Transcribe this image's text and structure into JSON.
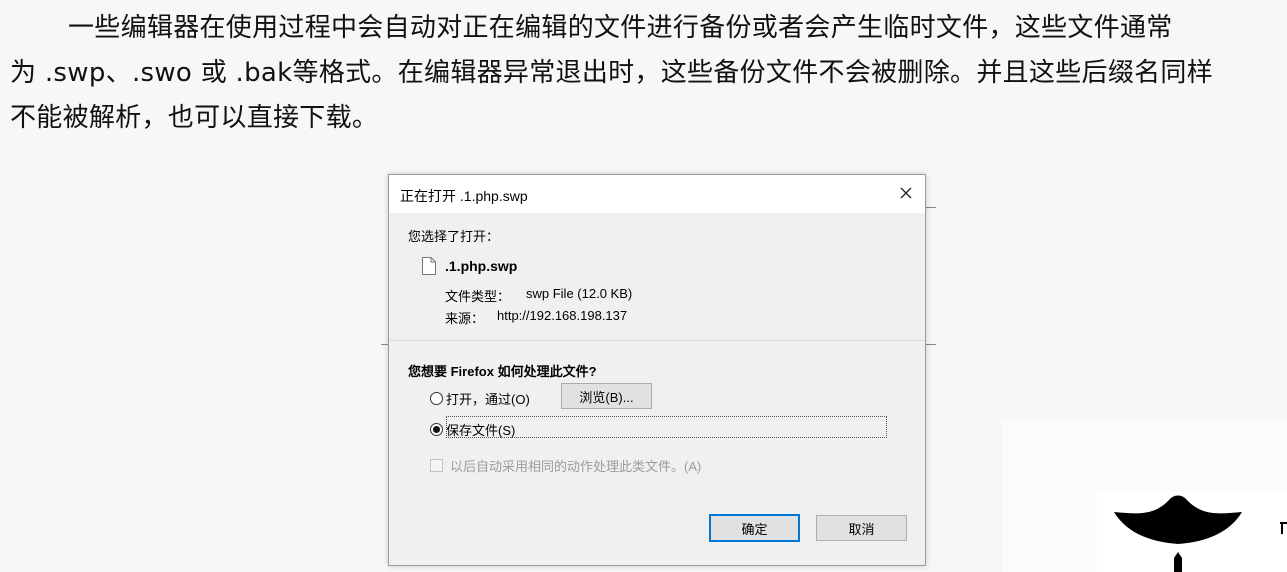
{
  "article": {
    "line1": "一些编辑器在使用过程中会自动对正在编辑的文件进行备份或者会产生临时文件，这些文件通常",
    "line2": "为 .swp、.swo 或 .bak等格式。在编辑器异常退出时，这些备份文件不会被删除。并且这些后缀名同样",
    "line3": "不能被解析，也可以直接下载。"
  },
  "dialog": {
    "title": "正在打开 .1.php.swp",
    "you_chose": "您选择了打开：",
    "file_name": ".1.php.swp",
    "type_label": "文件类型：",
    "type_value": "swp File (12.0 KB)",
    "source_label": "来源：",
    "source_value": "http://192.168.198.137",
    "question": "您想要 Firefox 如何处理此文件?",
    "open_with_label": "打开，通过(O)",
    "browse_button": "浏览(B)...",
    "save_file_label": "保存文件(S)",
    "auto_label": "以后自动采用相同的动作处理此类文件。(A)",
    "ok_button": "确定",
    "cancel_button": "取消",
    "selected_option": "save_file"
  },
  "icons": {
    "close": "close-icon",
    "file": "file-icon",
    "crown": "crown-logo"
  }
}
